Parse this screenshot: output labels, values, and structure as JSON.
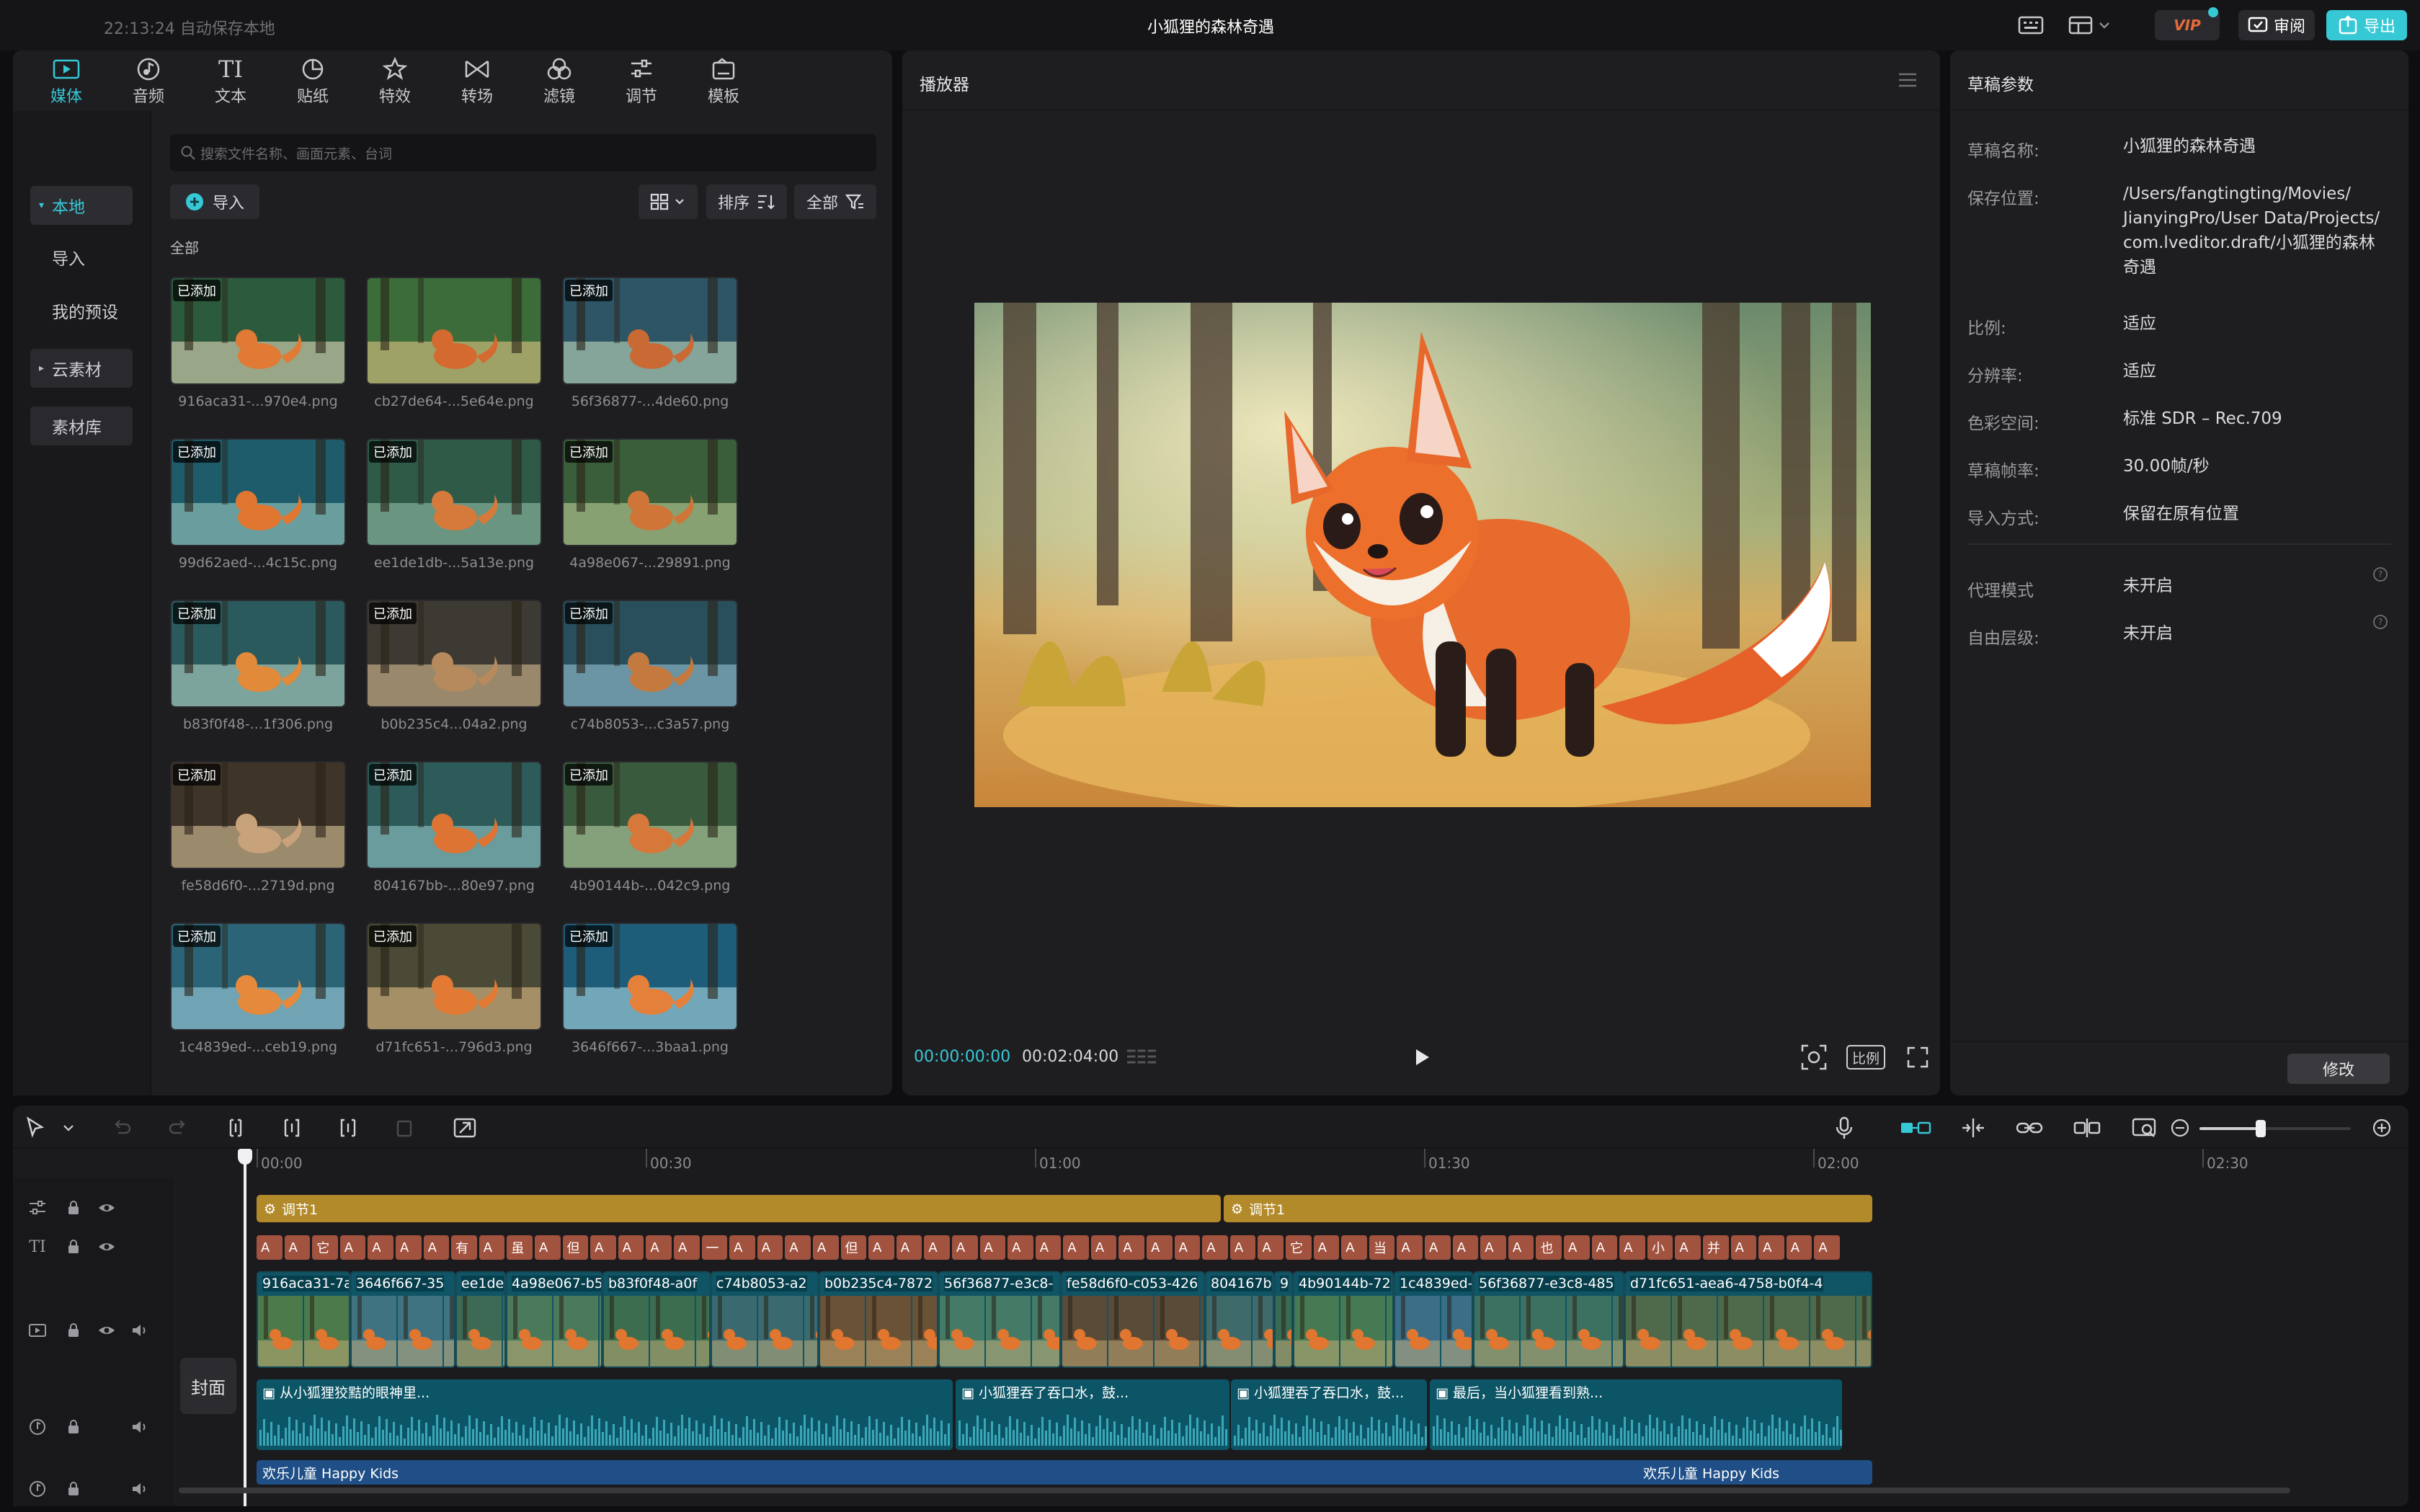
{
  "titlebar": {
    "autosave": "22:13:24 自动保存本地",
    "project_title": "小狐狸的森林奇遇",
    "vip": "VIP",
    "review": "审阅",
    "export": "导出"
  },
  "tabs": [
    {
      "label": "媒体",
      "icon": "media-icon"
    },
    {
      "label": "音频",
      "icon": "audio-icon"
    },
    {
      "label": "文本",
      "icon": "text-icon"
    },
    {
      "label": "贴纸",
      "icon": "sticker-icon"
    },
    {
      "label": "特效",
      "icon": "effects-icon"
    },
    {
      "label": "转场",
      "icon": "transition-icon"
    },
    {
      "label": "滤镜",
      "icon": "filter-icon"
    },
    {
      "label": "调节",
      "icon": "adjust-icon"
    },
    {
      "label": "模板",
      "icon": "template-icon"
    }
  ],
  "media_sidebar": {
    "local": "本地",
    "import": "导入",
    "presets": "我的预设",
    "cloud": "云素材",
    "library": "素材库"
  },
  "media": {
    "search_placeholder": "搜索文件名称、画面元素、台词",
    "import_btn": "导入",
    "sort_btn": "排序",
    "filter_btn": "全部",
    "section": "全部",
    "added_badge": "已添加",
    "items": [
      {
        "name": "916aca31-...970e4.png",
        "added": true
      },
      {
        "name": "cb27de64-...5e64e.png",
        "added": false
      },
      {
        "name": "56f36877-...4de60.png",
        "added": true
      },
      {
        "name": "99d62aed-...4c15c.png",
        "added": true
      },
      {
        "name": "ee1de1db-...5a13e.png",
        "added": true
      },
      {
        "name": "4a98e067-...29891.png",
        "added": true
      },
      {
        "name": "b83f0f48-...1f306.png",
        "added": true
      },
      {
        "name": "b0b235c4...04a2.png",
        "added": true
      },
      {
        "name": "c74b8053-...c3a57.png",
        "added": true
      },
      {
        "name": "fe58d6f0-...2719d.png",
        "added": true
      },
      {
        "name": "804167bb-...80e97.png",
        "added": true
      },
      {
        "name": "4b90144b-...042c9.png",
        "added": true
      },
      {
        "name": "1c4839ed-...ceb19.png",
        "added": true
      },
      {
        "name": "d71fc651-...796d3.png",
        "added": true
      },
      {
        "name": "3646f667-...3baa1.png",
        "added": true
      }
    ]
  },
  "player": {
    "title": "播放器",
    "current_time": "00:00:00:00",
    "total_time": "00:02:04:00",
    "ratio_btn": "比例"
  },
  "params": {
    "title": "草稿参数",
    "rows": [
      {
        "label": "草稿名称:",
        "value": "小狐狸的森林奇遇"
      },
      {
        "label": "保存位置:",
        "value": "/Users/fangtingting/Movies/ JianyingPro/User Data/Projects/ com.lveditor.draft/小狐狸的森林 奇遇"
      },
      {
        "label": "比例:",
        "value": "适应"
      },
      {
        "label": "分辨率:",
        "value": "适应"
      },
      {
        "label": "色彩空间:",
        "value": "标准 SDR – Rec.709"
      },
      {
        "label": "草稿帧率:",
        "value": "30.00帧/秒"
      },
      {
        "label": "导入方式:",
        "value": "保留在原有位置"
      },
      {
        "label": "代理模式",
        "value": "未开启"
      },
      {
        "label": "自由层级:",
        "value": "未开启"
      }
    ],
    "modify_btn": "修改"
  },
  "timeline": {
    "ruler": [
      "00:00",
      "00:30",
      "01:00",
      "01:30",
      "02:00",
      "02:30"
    ],
    "cover_label": "封面",
    "adjust_clips": [
      "调节1",
      "调节1"
    ],
    "text_clips": [
      "A",
      "A",
      "它",
      "A",
      "A",
      "A",
      "A",
      "有",
      "A",
      "虽",
      "A",
      "但",
      "A",
      "A",
      "A",
      "A",
      "一",
      "A",
      "A",
      "A",
      "A",
      "但",
      "A",
      "A",
      "A",
      "A",
      "A",
      "A",
      "A",
      "A",
      "A",
      "A",
      "A",
      "A",
      "A",
      "A",
      "A",
      "它",
      "A",
      "A",
      "当",
      "A",
      "A",
      "A",
      "A",
      "A",
      "也",
      "A",
      "A",
      "A",
      "小",
      "A",
      "并",
      "A",
      "A",
      "A",
      "A"
    ],
    "video_clips": [
      "916aca31-7a",
      "3646f667-35",
      "ee1de",
      "4a98e067-b5",
      "b83f0f48-a0f",
      "c74b8053-a2",
      "b0b235c4-7872",
      "56f36877-e3c8-",
      "fe58d6f0-c053-426",
      "804167b",
      "9",
      "4b90144b-72",
      "1c4839ed-",
      "56f36877-e3c8-485",
      "d71fc651-aea6-4758-b0f4-4"
    ],
    "voice_clips": [
      "从小狐狸狡黠的眼神里...",
      "小狐狸吞了吞口水，鼓...",
      "小狐狸吞了吞口水，鼓...",
      "最后，当小狐狸看到熟..."
    ],
    "music_clips": [
      "欢乐儿童 Happy Kids",
      "欢乐儿童 Happy Kids"
    ]
  },
  "colors": {
    "accent": "#37c8d6",
    "panel": "#1e1e21",
    "adjust": "#b38a2a",
    "text_clip": "#a2533f",
    "video_clip": "#0f5566",
    "music_clip": "#1f4f86"
  }
}
